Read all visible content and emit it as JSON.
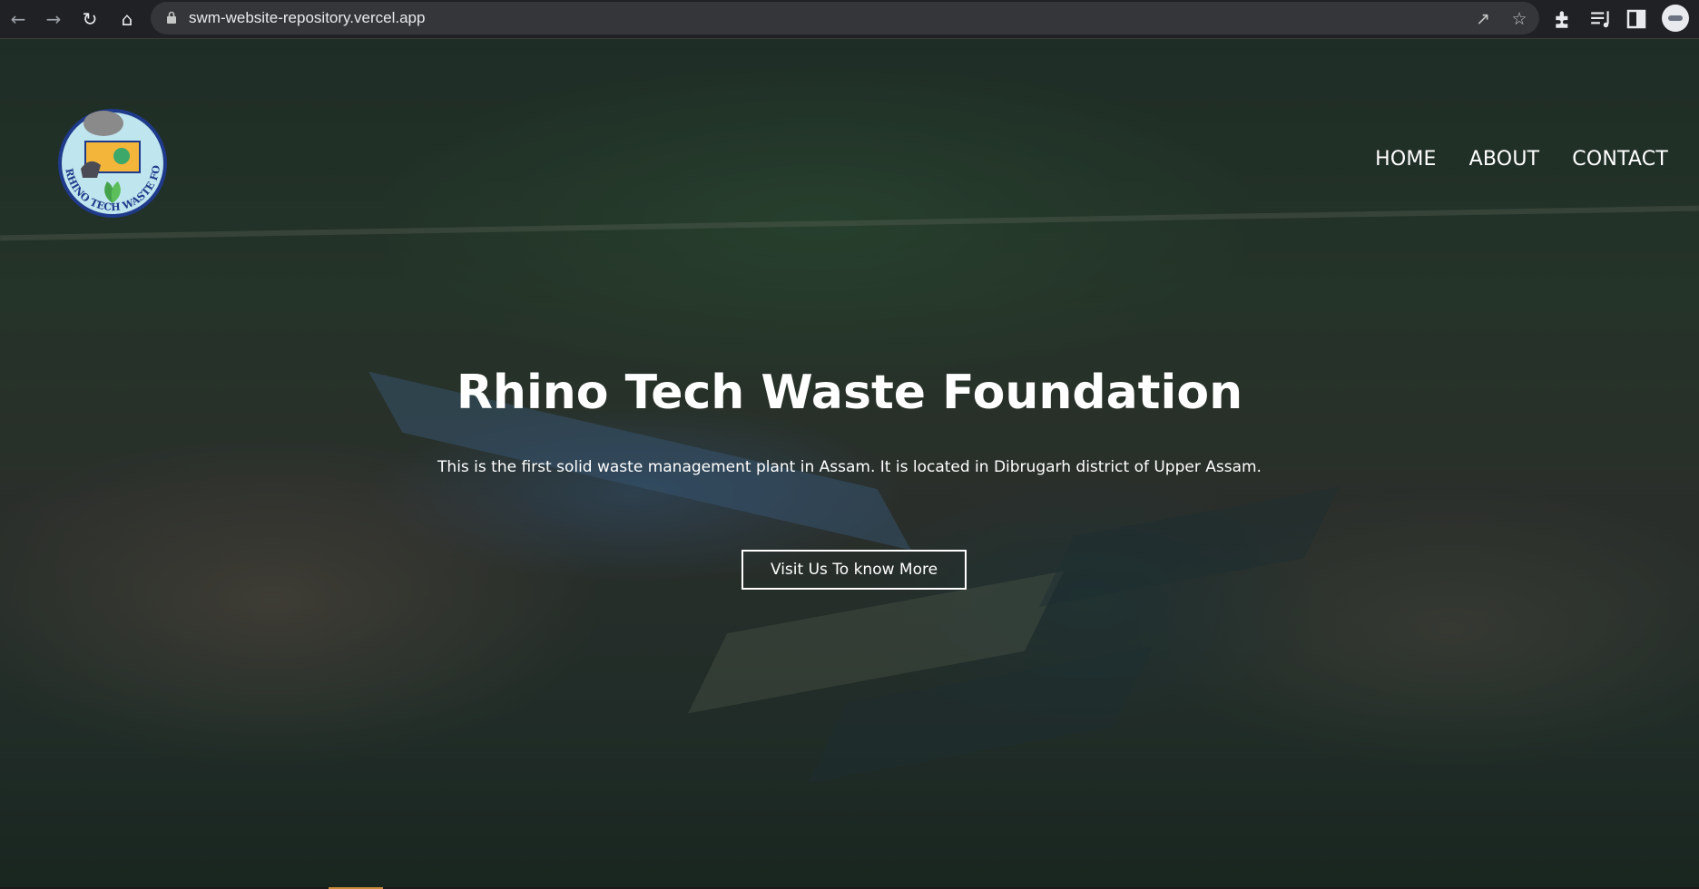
{
  "browser": {
    "url": "swm-website-repository.vercel.app"
  },
  "site": {
    "logo_text": "RHINO TECH WASTE FOUNDATION",
    "nav": [
      {
        "label": "HOME"
      },
      {
        "label": "ABOUT"
      },
      {
        "label": "CONTACT"
      }
    ],
    "hero": {
      "title": "Rhino Tech Waste Foundation",
      "subtitle": "This is the first solid waste management plant in Assam. It is located in Dibrugarh district of Upper Assam.",
      "button": "Visit Us To know More"
    }
  },
  "colors": {
    "chrome_bg": "#202124",
    "omnibox_bg": "#35363a",
    "text": "#ffffff"
  }
}
